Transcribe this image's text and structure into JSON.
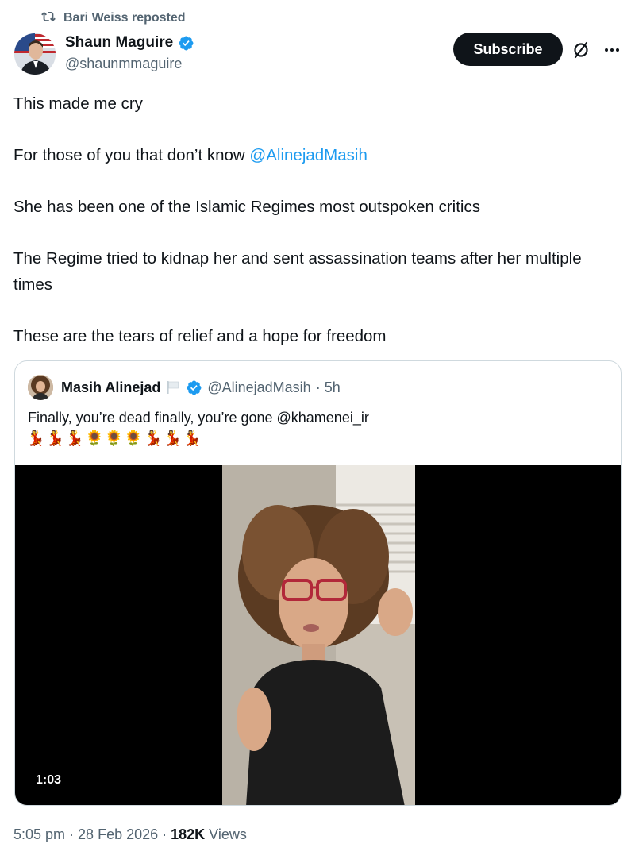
{
  "repost": {
    "label": "Bari Weiss reposted",
    "icon": "repost-icon"
  },
  "author": {
    "name": "Shaun Maguire",
    "handle": "@shaunmmaguire",
    "verified": true
  },
  "actions": {
    "subscribe_label": "Subscribe"
  },
  "tweet": {
    "line1": "This made me cry",
    "line2_prefix": "For those of you that don’t know ",
    "line2_mention": "@AlinejadMasih",
    "line3": "She has been one of the Islamic Regimes most outspoken critics",
    "line4": "The Regime tried to kidnap her and sent assassination teams after her multiple times",
    "line5": "These are the tears of relief and a hope for freedom"
  },
  "quote": {
    "name": "Masih Alinejad",
    "handle": "@AlinejadMasih",
    "time": "· 5h",
    "text": "Finally, you’re dead finally, you’re gone  @khamenei_ir",
    "emojis": "💃💃💃🌻🌻🌻💃💃💃",
    "video_duration": "1:03"
  },
  "meta": {
    "time": "5:05 pm",
    "sep1": " · ",
    "date": "28 Feb 2026",
    "sep2": " · ",
    "views_count": "182K",
    "views_label": " Views"
  },
  "colors": {
    "accent": "#1d9bf0",
    "text": "#0f1419",
    "muted": "#536471",
    "border": "#cfd9de"
  }
}
